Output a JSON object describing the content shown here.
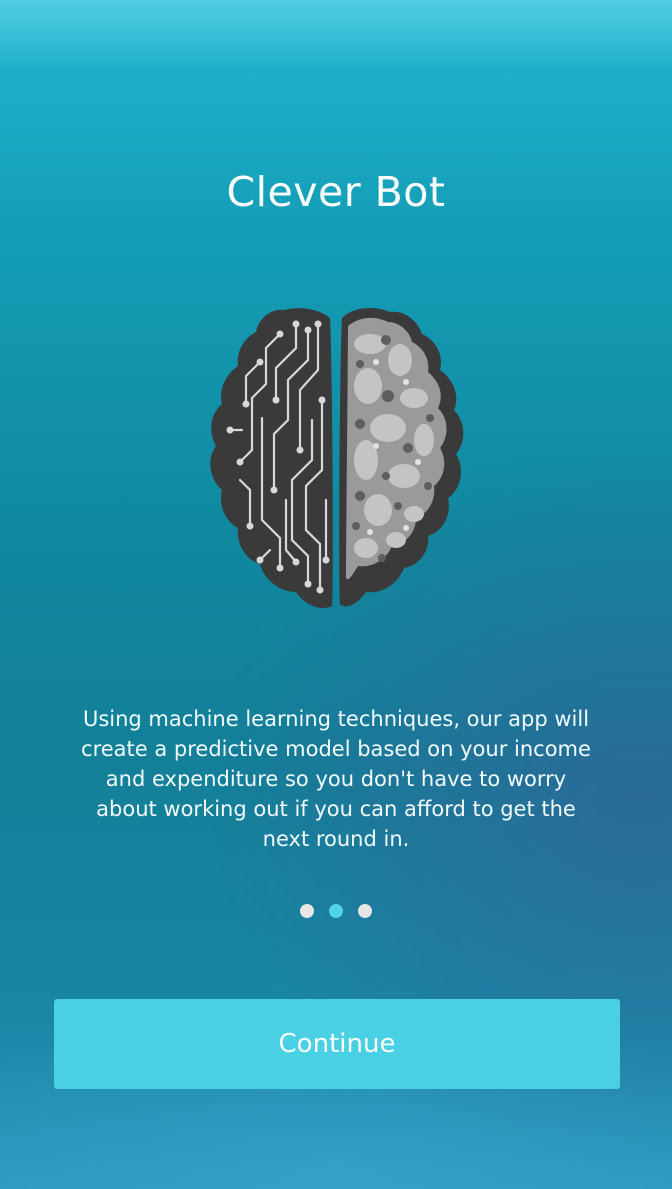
{
  "onboarding": {
    "title": "Clever Bot",
    "illustration_icon": "brain-circuit-icon",
    "description": "Using machine learning techniques, our app will create a predictive model based on your income and expenditure so you don't have to worry about working out if you can afford to get the next round in.",
    "pagination": {
      "total_pages": 3,
      "active_page": 2
    },
    "continue_label": "Continue"
  },
  "colors": {
    "accent": "#4ad0e4",
    "active_dot": "#4fd2ea",
    "inactive_dot": "#e6e6e6",
    "text": "#ffffff",
    "brain_dark": "#3a3a3a",
    "brain_light": "#a8a8a8"
  }
}
